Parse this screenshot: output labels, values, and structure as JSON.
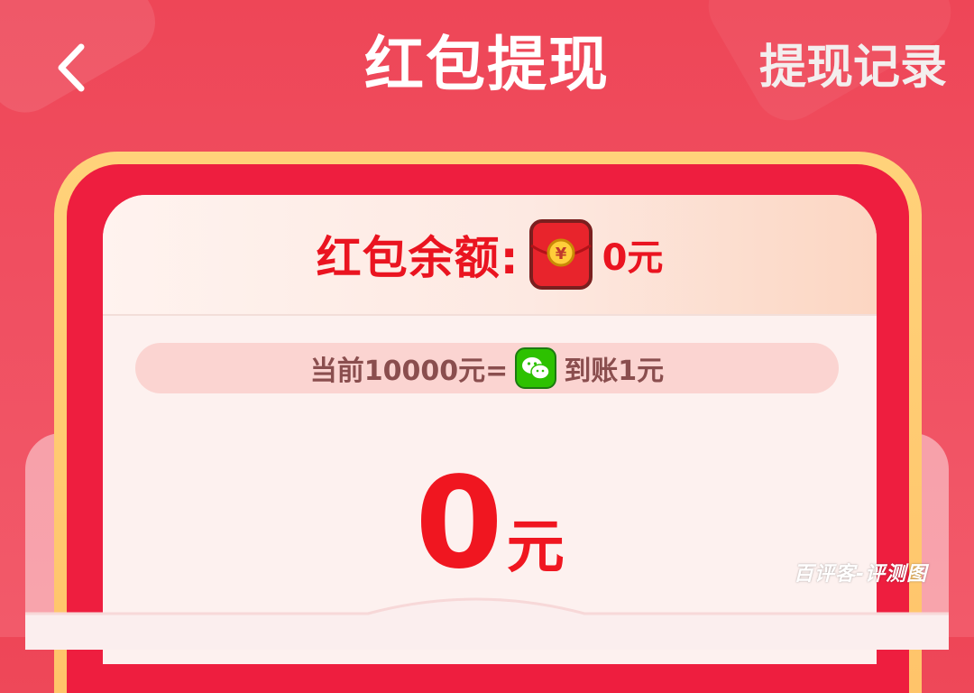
{
  "header": {
    "title": "红包提现",
    "records_label": "提现记录"
  },
  "balance": {
    "label": "红包余额:",
    "value": "0元"
  },
  "rate": {
    "prefix": "当前10000元=",
    "suffix": "到账1元"
  },
  "amount": {
    "value": "0",
    "unit": "元"
  },
  "watermark": "百评客-评测图",
  "icons": {
    "back": "chevron-left-icon",
    "red_packet": "red-packet-icon",
    "wechat": "wechat-icon"
  },
  "colors": {
    "background": "#ee4657",
    "accent_red": "#ea1420",
    "card_border": "#ffc46a",
    "wechat_green": "#2dc100"
  }
}
